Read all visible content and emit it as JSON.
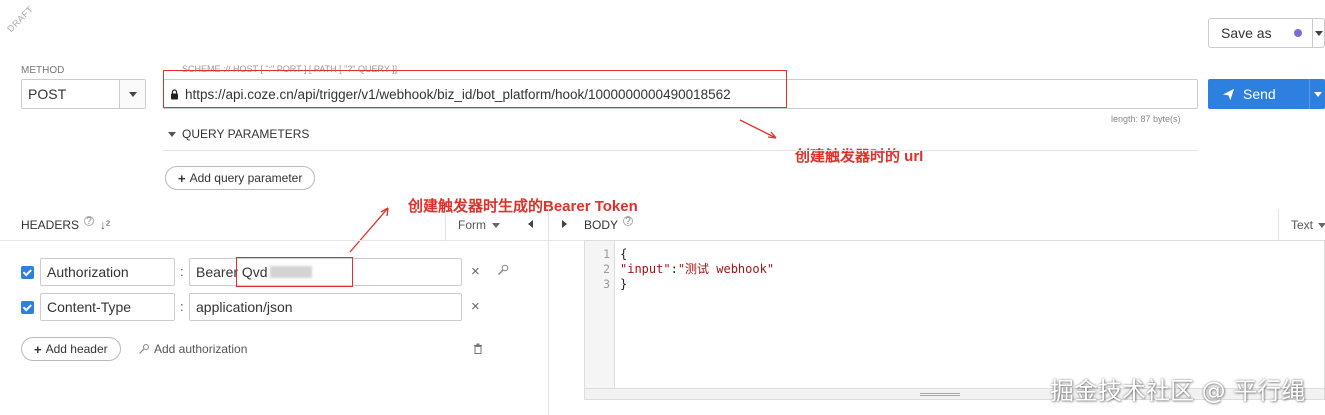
{
  "draft": "DRAFT",
  "method": {
    "label": "METHOD",
    "value": "POST"
  },
  "url": {
    "hint": "SCHEME :// HOST [ \":\" PORT ] [ PATH [ \"?\" QUERY ]]",
    "value": "https://api.coze.cn/api/trigger/v1/webhook/biz_id/bot_platform/hook/1000000000490018562",
    "length": "length: 87 byte(s)"
  },
  "save_as": {
    "label": "Save as",
    "dot_color": "#7b6cd9"
  },
  "send": {
    "label": "Send",
    "color": "#2d7fe0"
  },
  "query": {
    "title": "QUERY PARAMETERS",
    "add_label": "Add query parameter"
  },
  "headers": {
    "title": "HEADERS",
    "mode": "Form",
    "rows": [
      {
        "key": "Authorization",
        "value_prefix": "Bearer ",
        "value_visible": "Qvd",
        "checked": true
      },
      {
        "key": "Content-Type",
        "value": "application/json",
        "checked": true
      }
    ],
    "add_header": "Add header",
    "add_auth": "Add authorization"
  },
  "body": {
    "title": "BODY",
    "mode": "Text",
    "lines": [
      "1",
      "2",
      "3"
    ],
    "code": {
      "open": "{",
      "key": "\"input\"",
      "colon": ":",
      "value": "\"测试 webhook\"",
      "close": "}"
    }
  },
  "annotations": {
    "url_note": "创建触发器时的 url",
    "token_note": "创建触发器时生成的Bearer Token",
    "color": "#e0302a"
  },
  "watermark": "掘金技术社区 @ 平行绳"
}
